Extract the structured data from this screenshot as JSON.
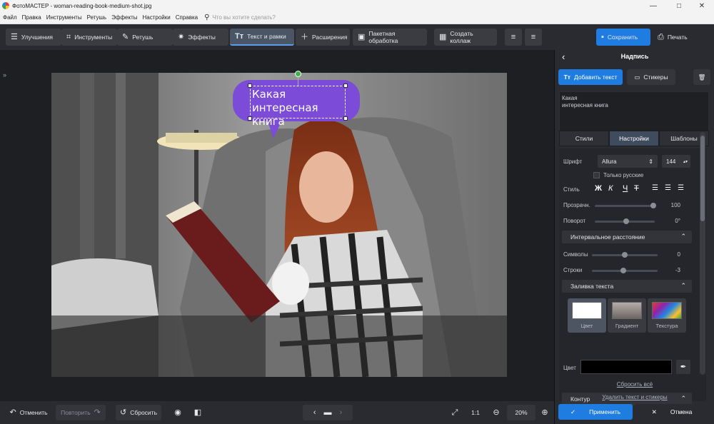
{
  "titlebar": {
    "title": "ФотоМАСТЕР - woman-reading-book-medium-shot.jpg",
    "minimize": "—",
    "maximize": "□",
    "close": "✕"
  },
  "menu": {
    "items": [
      "Файл",
      "Правка",
      "Инструменты",
      "Ретушь",
      "Эффекты",
      "Настройки",
      "Справка"
    ],
    "search_placeholder": "Что вы хотите сделать?"
  },
  "toolbar": {
    "tabs": [
      {
        "label": "Улучшения",
        "icon": "sliders-icon"
      },
      {
        "label": "Инструменты",
        "icon": "crop-icon"
      },
      {
        "label": "Ретушь",
        "icon": "brush-icon"
      },
      {
        "label": "Эффекты",
        "icon": "sparkle-icon"
      },
      {
        "label": "Текст и рамки",
        "icon": "text-icon"
      },
      {
        "label": "Расширения",
        "icon": "plus-icon"
      },
      {
        "label": "Пакетная обработка",
        "icon": "images-icon"
      },
      {
        "label": "Создать коллаж",
        "icon": "collage-icon"
      }
    ],
    "active_tab": "Текст и рамки",
    "save_label": "Сохранить",
    "print_label": "Печать"
  },
  "canvas": {
    "text_line1": "Какая",
    "text_line2": "интересная  книга",
    "bubble_color": "#7c4bd8"
  },
  "bottombar": {
    "undo": "Отменить",
    "redo": "Повторить",
    "reset": "Сбросить",
    "ratio": "1:1",
    "zoom": "20%"
  },
  "panel": {
    "title": "Надпись",
    "add_text": "Добавить текст",
    "stickers": "Стикеры",
    "text_preview_line1": "Какая",
    "text_preview_line2": "интересная  книга",
    "tabs": [
      "Стили",
      "Настройки",
      "Шаблоны"
    ],
    "active_tab": "Настройки",
    "font_label": "Шрифт",
    "font_value": "Allura",
    "font_size": "144",
    "russian_only": "Только русские",
    "style_label": "Стиль",
    "style_buttons": [
      "Ж",
      "К",
      "Ч",
      "Т"
    ],
    "opacity_label": "Прозрачн.",
    "opacity_value": "100",
    "rotation_label": "Поворот",
    "rotation_value": "0°",
    "spacing_section": "Интервальное расстояние",
    "chars_label": "Символы",
    "chars_value": "0",
    "lines_label": "Строки",
    "lines_value": "-3",
    "fill_section": "Заливка текста",
    "fill_options": [
      "Цвет",
      "Градиент",
      "Текстура"
    ],
    "outline_section": "Контур",
    "outline_color_label": "Цвет",
    "outline_color": "#000000",
    "reset_all": "Сбросить всё",
    "delete_all": "Удалить текст и стикеры",
    "apply": "Применить",
    "cancel": "Отмена"
  },
  "colors": {
    "accent": "#1f7ce0",
    "bubble": "#7c4bd8",
    "handle": "#3bb54a"
  }
}
